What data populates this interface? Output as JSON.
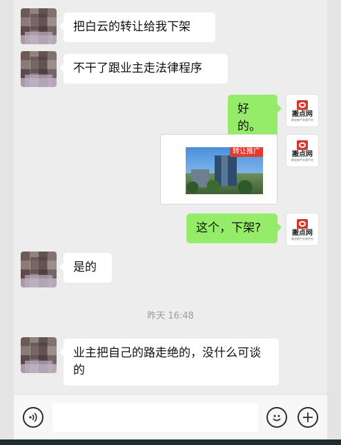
{
  "messages": {
    "m1": "把白云的转让给我下架",
    "m2": "不干了跟业主走法律程序",
    "m3": "好的。",
    "m4_tag": "转让推广",
    "m5": "这个，下架?",
    "m6": "是的",
    "time": "昨天 16:48",
    "m7": "业主把自己的路走绝的，没什么可谈的"
  },
  "brand": {
    "name": "搬点网",
    "sub": "商业地产交易平台"
  },
  "input": {
    "placeholder": ""
  },
  "colors": {
    "outgoing_bubble": "#95ec69",
    "incoming_bubble": "#ffffff",
    "chat_background": "#ededed",
    "brand_red": "#d63a2a"
  }
}
